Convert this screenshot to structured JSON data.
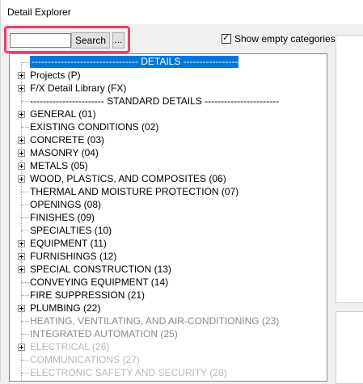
{
  "window": {
    "title": "Detail Explorer"
  },
  "toolbar": {
    "search_value": "",
    "search_label": "Search",
    "more_label": "...",
    "show_empty_label": "Show empty categories",
    "show_empty_checked": true
  },
  "tree": {
    "items": [
      {
        "label": "--------------------------------- DETAILS --------------------------------",
        "expandable": false,
        "selected": true,
        "style": "normal"
      },
      {
        "label": "Projects (P)",
        "expandable": true,
        "style": "normal"
      },
      {
        "label": "F/X Detail Library (FX)",
        "expandable": true,
        "style": "normal"
      },
      {
        "label": "----------------------- STANDARD DETAILS -----------------------",
        "expandable": false,
        "style": "normal"
      },
      {
        "label": "GENERAL (01)",
        "expandable": true,
        "style": "normal"
      },
      {
        "label": "EXISTING CONDITIONS (02)",
        "expandable": false,
        "style": "normal"
      },
      {
        "label": "CONCRETE (03)",
        "expandable": true,
        "style": "normal"
      },
      {
        "label": "MASONRY (04)",
        "expandable": true,
        "style": "normal"
      },
      {
        "label": "METALS (05)",
        "expandable": true,
        "style": "normal"
      },
      {
        "label": "WOOD, PLASTICS, AND COMPOSITES (06)",
        "expandable": true,
        "style": "normal"
      },
      {
        "label": "THERMAL AND MOISTURE PROTECTION (07)",
        "expandable": false,
        "style": "normal"
      },
      {
        "label": "OPENINGS (08)",
        "expandable": false,
        "style": "normal"
      },
      {
        "label": "FINISHES (09)",
        "expandable": false,
        "style": "normal"
      },
      {
        "label": "SPECIALTIES (10)",
        "expandable": false,
        "style": "normal"
      },
      {
        "label": "EQUIPMENT (11)",
        "expandable": true,
        "style": "normal"
      },
      {
        "label": "FURNISHINGS (12)",
        "expandable": true,
        "style": "normal"
      },
      {
        "label": "SPECIAL CONSTRUCTION (13)",
        "expandable": true,
        "style": "normal"
      },
      {
        "label": "CONVEYING EQUIPMENT (14)",
        "expandable": false,
        "style": "normal"
      },
      {
        "label": "FIRE SUPPRESSION (21)",
        "expandable": false,
        "style": "normal"
      },
      {
        "label": "PLUMBING (22)",
        "expandable": true,
        "style": "normal"
      },
      {
        "label": "HEATING, VENTILATING, AND AIR-CONDITIONING (23)",
        "expandable": false,
        "style": "grey"
      },
      {
        "label": "INTEGRATED AUTOMATION (25)",
        "expandable": false,
        "style": "grey"
      },
      {
        "label": "ELECTRICAL (26)",
        "expandable": true,
        "style": "lightgrey"
      },
      {
        "label": "COMMUNICATIONS (27)",
        "expandable": false,
        "style": "lightgrey"
      },
      {
        "label": "ELECTRONIC SAFETY AND SECURITY (28)",
        "expandable": false,
        "style": "lightgrey"
      }
    ]
  },
  "colors": {
    "selection": "#0078d7",
    "highlight": "#ec3f6a"
  }
}
